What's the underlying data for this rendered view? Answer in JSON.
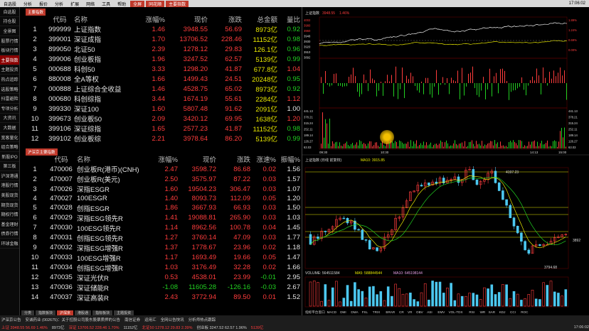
{
  "menubar": {
    "items": [
      "自选股",
      "分析",
      "报价",
      "分析",
      "扩展",
      "网络",
      "工具",
      "帮助"
    ],
    "tabs": [
      "全屏",
      "同花顺",
      "主要指数"
    ],
    "time": "17:06:02"
  },
  "sidebar": {
    "items": [
      "自选股",
      "持仓股",
      "全景图",
      "股票行情",
      "板块行情",
      "主要指数",
      "主题投资",
      "热点追踪",
      "选股策略",
      "扫雷避险",
      "专项分析",
      "大资讯",
      "大数据",
      "宽客量化",
      "组合策略",
      "新股IPO",
      "第三板",
      "沪深港通",
      "港股行情",
      "美股现货",
      "期货现货",
      "期权行情",
      "基金理财",
      "债券行情",
      "环球金融"
    ],
    "active_index": 5
  },
  "top_panel": {
    "tab_label": "主要指数",
    "headers": [
      "代码",
      "名称",
      "涨幅%",
      "现价",
      "涨跌",
      "总金额",
      "量比"
    ],
    "rows": [
      {
        "idx": "1",
        "code": "999999",
        "name": "上证指数",
        "chg": "1.46",
        "price": "3948.55",
        "diff": "56.69",
        "amt": "8973亿",
        "vr": "0.92",
        "vr_color": "green"
      },
      {
        "idx": "2",
        "code": "399001",
        "name": "深证成指",
        "chg": "1.70",
        "price": "13706.52",
        "diff": "228.46",
        "amt": "11152亿",
        "vr": "0.98",
        "vr_color": "green"
      },
      {
        "idx": "3",
        "code": "899050",
        "name": "北证50",
        "chg": "2.39",
        "price": "1278.12",
        "diff": "29.83",
        "amt": "126.1亿",
        "vr": "0.96",
        "vr_color": "green"
      },
      {
        "idx": "4",
        "code": "399006",
        "name": "创业板指",
        "chg": "1.96",
        "price": "3247.52",
        "diff": "62.57",
        "amt": "5139亿",
        "vr": "0.99",
        "vr_color": "green"
      },
      {
        "idx": "5",
        "code": "000688",
        "name": "科创50",
        "chg": "3.33",
        "price": "1298.20",
        "diff": "41.87",
        "amt": "677.8亿",
        "vr": "1.04",
        "vr_color": "red"
      },
      {
        "idx": "6",
        "code": "880008",
        "name": "全A等权",
        "chg": "1.66",
        "price": "1499.43",
        "diff": "24.51",
        "amt": "20248亿",
        "vr": "0.95",
        "vr_color": "green"
      },
      {
        "idx": "7",
        "code": "000888",
        "name": "上证综合全收益",
        "chg": "1.46",
        "price": "4528.75",
        "diff": "65.02",
        "amt": "8973亿",
        "vr": "0.92",
        "vr_color": "green"
      },
      {
        "idx": "8",
        "code": "000680",
        "name": "科创综指",
        "chg": "3.44",
        "price": "1674.19",
        "diff": "55.61",
        "amt": "2284亿",
        "vr": "1.12",
        "vr_color": "red"
      },
      {
        "idx": "9",
        "code": "399330",
        "name": "深证100",
        "chg": "1.60",
        "price": "5807.48",
        "diff": "91.62",
        "amt": "2091亿",
        "vr": "1.00",
        "vr_color": "white"
      },
      {
        "idx": "10",
        "code": "399673",
        "name": "创业板50",
        "chg": "2.09",
        "price": "3420.12",
        "diff": "69.95",
        "amt": "1638亿",
        "vr": "1.20",
        "vr_color": "red"
      },
      {
        "idx": "11",
        "code": "399106",
        "name": "深证综指",
        "chg": "1.65",
        "price": "2577.23",
        "diff": "41.87",
        "amt": "11152亿",
        "vr": "0.98",
        "vr_color": "green"
      },
      {
        "idx": "12",
        "code": "399102",
        "name": "创业板综",
        "chg": "2.21",
        "price": "3978.64",
        "diff": "86.20",
        "amt": "5139亿",
        "vr": "0.99",
        "vr_color": "green"
      }
    ]
  },
  "bottom_panel": {
    "tab_label": "沪深京主要指数",
    "headers": [
      "代码",
      "名称",
      "涨幅%",
      "现价",
      "涨跌",
      "涨速%",
      "振幅%"
    ],
    "rows": [
      {
        "idx": "1",
        "code": "470006",
        "name": "创业板R(港币)(CNH)",
        "chg": "2.47",
        "price": "3598.72",
        "diff": "86.68",
        "spd": "0.02",
        "amp": "1.56",
        "neg": false
      },
      {
        "idx": "2",
        "code": "470007",
        "name": "创业板R(美元)",
        "chg": "2.50",
        "price": "3575.97",
        "diff": "87.22",
        "spd": "0.03",
        "amp": "1.57",
        "neg": false
      },
      {
        "idx": "3",
        "code": "470026",
        "name": "深指ESGR",
        "chg": "1.60",
        "price": "19504.23",
        "diff": "306.47",
        "spd": "0.03",
        "amp": "1.07",
        "neg": false
      },
      {
        "idx": "4",
        "code": "470027",
        "name": "100ESGR",
        "chg": "1.40",
        "price": "8093.73",
        "diff": "112.09",
        "spd": "0.05",
        "amp": "1.20",
        "neg": false
      },
      {
        "idx": "5",
        "code": "470028",
        "name": "创指ESGR",
        "chg": "1.86",
        "price": "3667.93",
        "diff": "66.93",
        "spd": "0.03",
        "amp": "1.50",
        "neg": false
      },
      {
        "idx": "6",
        "code": "470029",
        "name": "深指ESG领先R",
        "chg": "1.41",
        "price": "19088.81",
        "diff": "265.90",
        "spd": "0.03",
        "amp": "1.03",
        "neg": false
      },
      {
        "idx": "7",
        "code": "470030",
        "name": "100ESG领先R",
        "chg": "1.14",
        "price": "8962.56",
        "diff": "100.78",
        "spd": "0.04",
        "amp": "1.45",
        "neg": false
      },
      {
        "idx": "8",
        "code": "470031",
        "name": "创指ESG领先R",
        "chg": "1.27",
        "price": "3760.14",
        "diff": "47.09",
        "spd": "0.03",
        "amp": "1.77",
        "neg": false
      },
      {
        "idx": "9",
        "code": "470032",
        "name": "深指ESG增强R",
        "chg": "1.37",
        "price": "1778.67",
        "diff": "23.96",
        "spd": "0.02",
        "amp": "1.18",
        "neg": false
      },
      {
        "idx": "10",
        "code": "470033",
        "name": "100ESG增强R",
        "chg": "1.17",
        "price": "1693.49",
        "diff": "19.66",
        "spd": "0.05",
        "amp": "1.47",
        "neg": false
      },
      {
        "idx": "11",
        "code": "470034",
        "name": "创指ESG增强R",
        "chg": "1.03",
        "price": "3176.49",
        "diff": "32.28",
        "spd": "0.02",
        "amp": "1.66",
        "neg": false
      },
      {
        "idx": "12",
        "code": "470035",
        "name": "深证光伏R",
        "chg": "0.53",
        "price": "4538.01",
        "diff": "23.99",
        "spd": "-0.01",
        "amp": "2.95",
        "neg": false
      },
      {
        "idx": "13",
        "code": "470036",
        "name": "深证储能R",
        "chg": "-1.08",
        "price": "11605.28",
        "diff": "-126.16",
        "spd": "-0.03",
        "amp": "2.67",
        "neg": true
      },
      {
        "idx": "14",
        "code": "470037",
        "name": "深证高装R",
        "chg": "2.43",
        "price": "3772.94",
        "diff": "89.50",
        "spd": "0.01",
        "amp": "1.52",
        "neg": false
      }
    ]
  },
  "bottom_tabs": [
    "分类",
    "指数板块",
    "沪深京",
    "港股通",
    "指标板块",
    "主题投资"
  ],
  "chart": {
    "intraday_title": "上证指数",
    "intraday_price": "3948.55",
    "intraday_chg": "1.46%",
    "y_labels_top": [
      "4002",
      "3980",
      "3960",
      "3948",
      "3930",
      "3920",
      "3910",
      "3892"
    ],
    "pct_labels": [
      "1.89%",
      "1.24%",
      "0.69%",
      "0.00%"
    ],
    "vol_labels": [
      "441.13",
      "378.21",
      "315.24",
      "252.11",
      "189.14",
      "126.27",
      "63.03"
    ],
    "time_labels": [
      "09:30",
      "10:30",
      "14:13",
      "15:00"
    ],
    "kline_title": "上证指数 (日线 前复权)",
    "ma_label": "MA10: 3915.85",
    "kline_high": "4197.23",
    "kline_low": "3794.68",
    "kline_price": "3892",
    "vol_title": "VOLUME: 564511584",
    "vol_ma5": "MA5: 588844544",
    "vol_ma10": "MA10: 645198144",
    "indicator_tabs": [
      "指标平台",
      "窗口",
      "MACD",
      "DMI",
      "DMA",
      "FSL",
      "TRIX",
      "BRAR",
      "CR",
      "VR",
      "OBV",
      "ASI",
      "EMV",
      "VOL-TDX",
      "RSI",
      "WR",
      "SAR",
      "KDJ",
      "CCI",
      "ROC"
    ]
  },
  "status": {
    "row1": [
      "沪深京公告",
      "安诚药业 (002675)：关于控股公司股东股票质押的公告",
      "南信证券",
      "运用汇",
      "全网公告快讯",
      "分析师热点跟踪"
    ],
    "row2": [
      "上证 3948.55 56.69 1.46%",
      "8973亿",
      "深证 13706.52 228.46 1.70%",
      "11152亿",
      "北证50 1278.12 29.83 2.39%",
      "创业板 3247.52 62.57 1.96%",
      "5139亿"
    ],
    "row2_right": "17:06:02"
  }
}
